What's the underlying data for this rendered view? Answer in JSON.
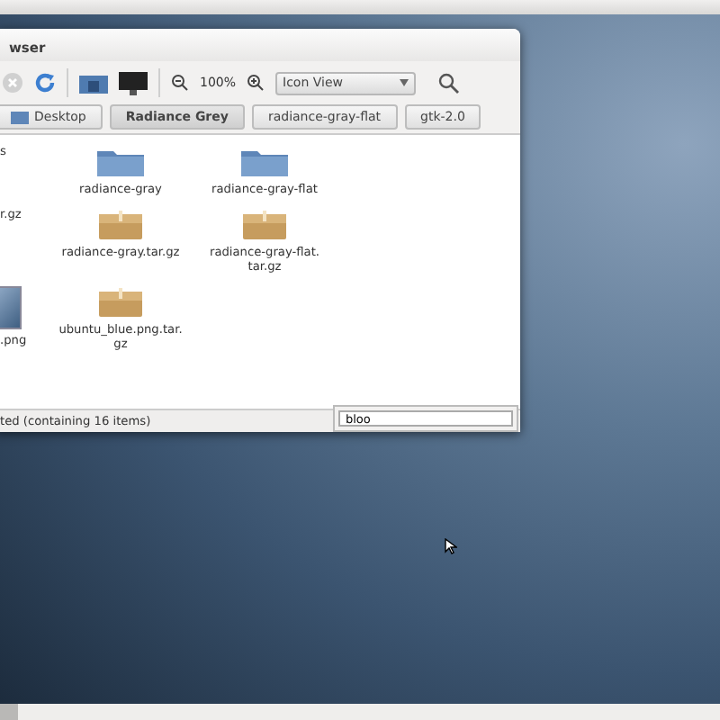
{
  "window": {
    "title": "wser",
    "toolbar": {
      "zoom": "100%",
      "view": "Icon View"
    },
    "path": [
      {
        "label": "Desktop",
        "selected": false
      },
      {
        "label": "Radiance Grey",
        "selected": true
      },
      {
        "label": "radiance-gray-flat",
        "selected": false
      },
      {
        "label": "gtk-2.0",
        "selected": false
      }
    ],
    "rows": [
      [
        {
          "kind": "text",
          "label": "s"
        },
        {
          "kind": "folder",
          "label": "radiance-gray"
        },
        {
          "kind": "folder",
          "label": "radiance-gray-flat"
        }
      ],
      [
        {
          "kind": "text",
          "label": "r.gz"
        },
        {
          "kind": "archive",
          "label": "radiance-gray.tar.gz"
        },
        {
          "kind": "archive",
          "label": "radiance-gray-flat.\ntar.gz"
        }
      ],
      [
        {
          "kind": "image",
          "label": ".png"
        },
        {
          "kind": "archive",
          "label": "ubuntu_blue.png.tar.\ngz"
        }
      ]
    ],
    "status": "ted (containing 16 items)",
    "search": {
      "value": "bloo"
    }
  }
}
